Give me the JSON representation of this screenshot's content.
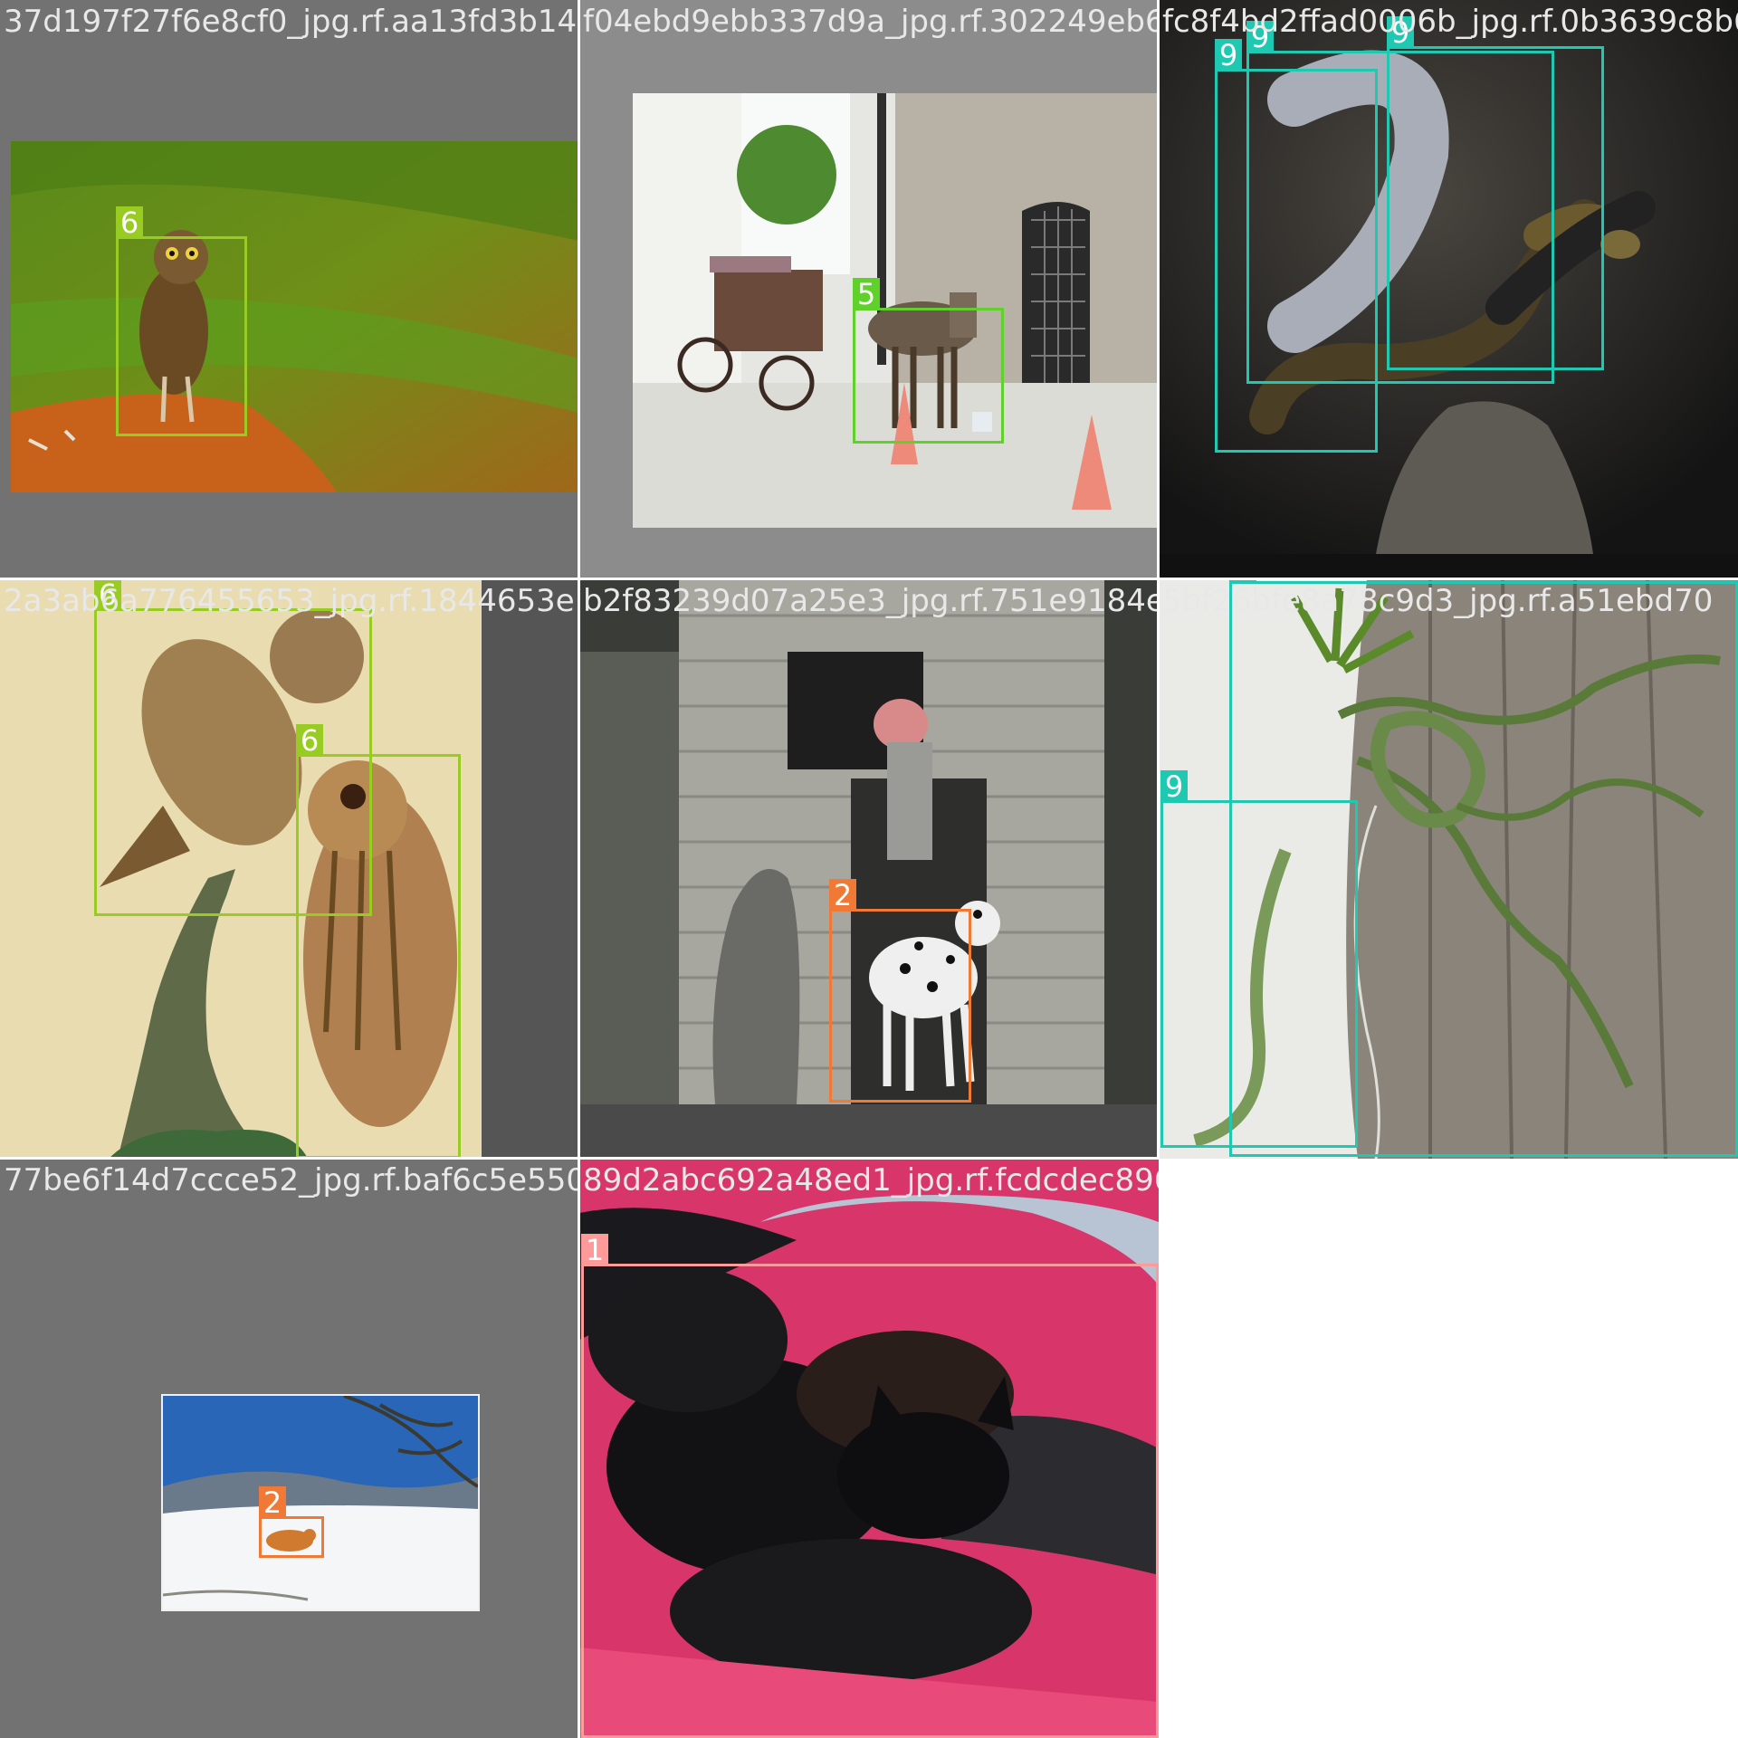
{
  "colors": {
    "class_1": "#ff9a9a",
    "class_2": "#f07a35",
    "class_5": "#5fd12a",
    "class_6": "#99cc22",
    "class_9": "#1fc8b0",
    "pad_gray": "#727272"
  },
  "tiles": [
    {
      "filename": "37d197f27f6e8cf0_jpg.rf.aa13fd3b14379492",
      "boxes": [
        {
          "label": "6"
        }
      ]
    },
    {
      "filename": "f04ebd9ebb337d9a_jpg.rf.302249eb6fbd8f424",
      "boxes": [
        {
          "label": "5"
        }
      ]
    },
    {
      "filename": "fc8f4bd2ffad0006b_jpg.rf.0b3639c8b68",
      "boxes": [
        {
          "label": "9"
        },
        {
          "label": "9"
        },
        {
          "label": "9"
        }
      ]
    },
    {
      "filename": "2a3ab6a776455653_jpg.rf.1844653e1b2083279",
      "boxes": [
        {
          "label": "6"
        },
        {
          "label": "6"
        }
      ]
    },
    {
      "filename": "b2f83239d07a25e3_jpg.rf.751e9184e5012b7e",
      "boxes": [
        {
          "label": "2"
        }
      ]
    },
    {
      "filename": "5bf26bfe8a78c9d3_jpg.rf.a51ebd70",
      "boxes": [
        {
          "label": "9"
        },
        {
          "label": "9"
        }
      ]
    },
    {
      "filename": "77be6f14d7ccce52_jpg.rf.baf6c5e550b99d2",
      "boxes": [
        {
          "label": "2"
        }
      ]
    },
    {
      "filename": "89d2abc692a48ed1_jpg.rf.fcdcdec89628940d",
      "boxes": [
        {
          "label": "1"
        }
      ]
    }
  ]
}
